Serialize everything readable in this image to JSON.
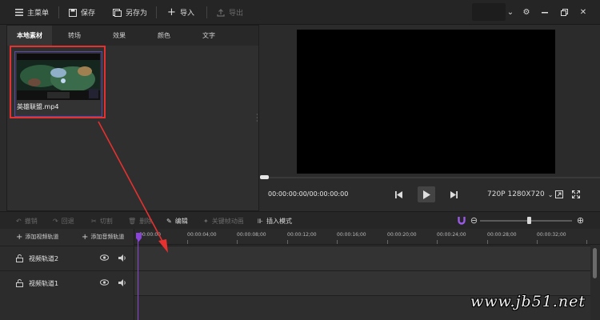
{
  "toolbar": {
    "main_menu": "主菜单",
    "save": "保存",
    "save_as": "另存为",
    "import": "导入",
    "export": "导出"
  },
  "media_panel": {
    "tabs": [
      "本地素材",
      "转场",
      "效果",
      "颜色",
      "文字"
    ],
    "active_tab": "本地素材",
    "items": [
      {
        "name": "英雄联盟.mp4"
      }
    ]
  },
  "preview": {
    "timecode": "00:00:00:00/00:00:00:00",
    "resolution": "720P 1280X720"
  },
  "edit_toolbar": {
    "undo": "撤销",
    "redo": "回退",
    "cut": "切割",
    "delete": "删除",
    "edit": "编辑",
    "keyframe": "关键帧动画",
    "insert_mode": "插入模式"
  },
  "timeline": {
    "add_video_track": "添加视频轨道",
    "add_audio_track": "添加音频轨道",
    "ruler": [
      "00:00:00",
      "00:00:04;00",
      "00:00:08;00",
      "00:00:12;00",
      "00:00:16;00",
      "00:00:20;00",
      "00:00:24;00",
      "00:00:28;00",
      "00:00:32;00"
    ],
    "tracks": [
      {
        "label": "视频轨道2"
      },
      {
        "label": "视频轨道1"
      }
    ]
  },
  "watermark": "www.jb51.net",
  "colors": {
    "accent": "#8a44d8",
    "annotation": "#e5312f"
  }
}
